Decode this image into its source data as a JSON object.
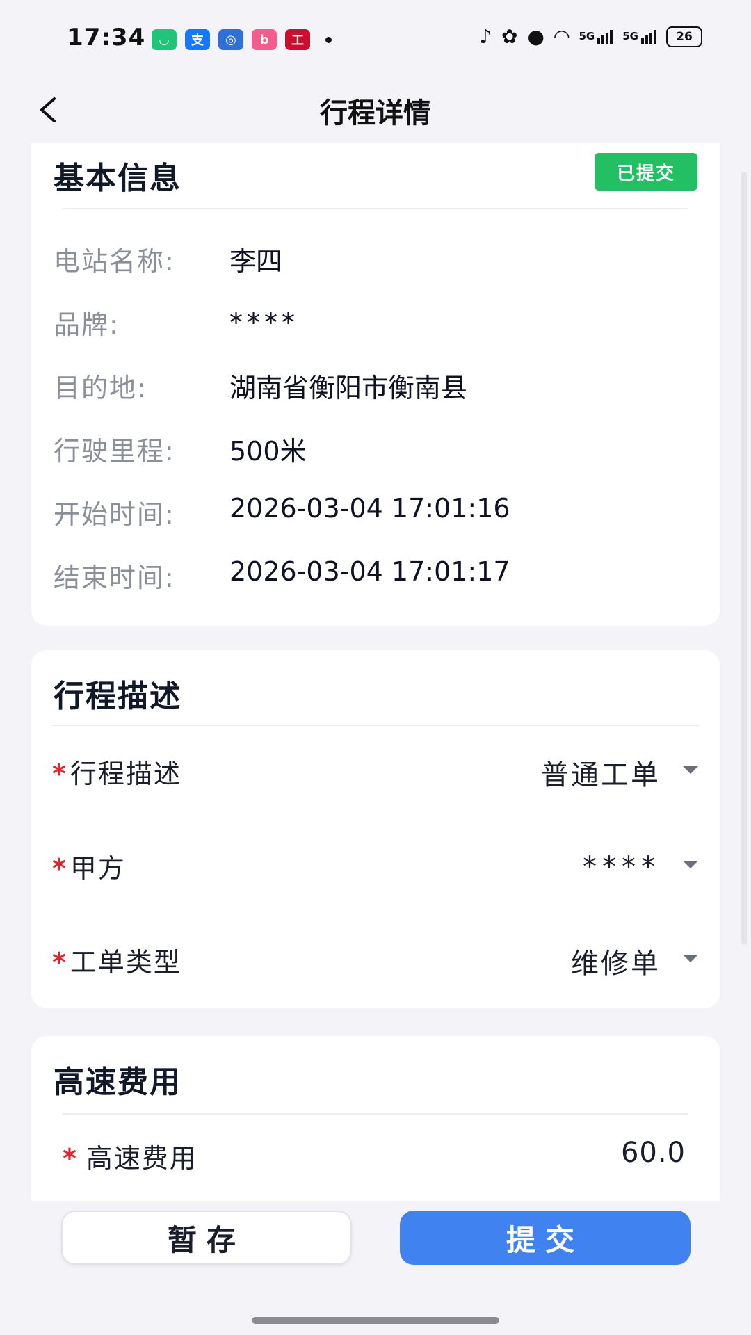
{
  "status_bar": {
    "time": "17:34",
    "app_icons": [
      {
        "name": "mi-home-app-icon",
        "glyph": "◡",
        "color": "#22c47a"
      },
      {
        "name": "alipay-app-icon",
        "glyph": "支",
        "color": "#1677ff"
      },
      {
        "name": "bank-app-icon",
        "glyph": "◎",
        "color": "#2f6fd6"
      },
      {
        "name": "bilibili-app-icon",
        "glyph": "b",
        "color": "#f25d8e"
      },
      {
        "name": "icbc-app-icon",
        "glyph": "工",
        "color": "#c8102e"
      }
    ],
    "network_1": "5G",
    "network_2": "5G",
    "battery": "26"
  },
  "header": {
    "title": "行程详情"
  },
  "basic_info": {
    "title": "基本信息",
    "status_badge": "已提交",
    "rows": [
      {
        "label": "电站名称:",
        "value": "李四"
      },
      {
        "label": "品牌:",
        "value": "****"
      },
      {
        "label": "目的地:",
        "value": "湖南省衡阳市衡南县"
      },
      {
        "label": "行驶里程:",
        "value": "500米"
      },
      {
        "label": "开始时间:",
        "value": "2026-03-04 17:01:16"
      },
      {
        "label": "结束时间:",
        "value": "2026-03-04 17:01:17"
      }
    ]
  },
  "trip_description": {
    "title": "行程描述",
    "required_mark": "*",
    "fields": [
      {
        "label": "行程描述",
        "value": "普通工单"
      },
      {
        "label": "甲方",
        "value": "****"
      },
      {
        "label": "工单类型",
        "value": "维修单"
      }
    ]
  },
  "highway_fee": {
    "title": "高速费用",
    "required_mark": "*",
    "label": "高速费用",
    "value": "60.0"
  },
  "actions": {
    "save_label": "暂存",
    "submit_label": "提交"
  },
  "colors": {
    "accent": "#3f82f0",
    "status_green": "#22bf63",
    "required_red": "#e0242e"
  }
}
